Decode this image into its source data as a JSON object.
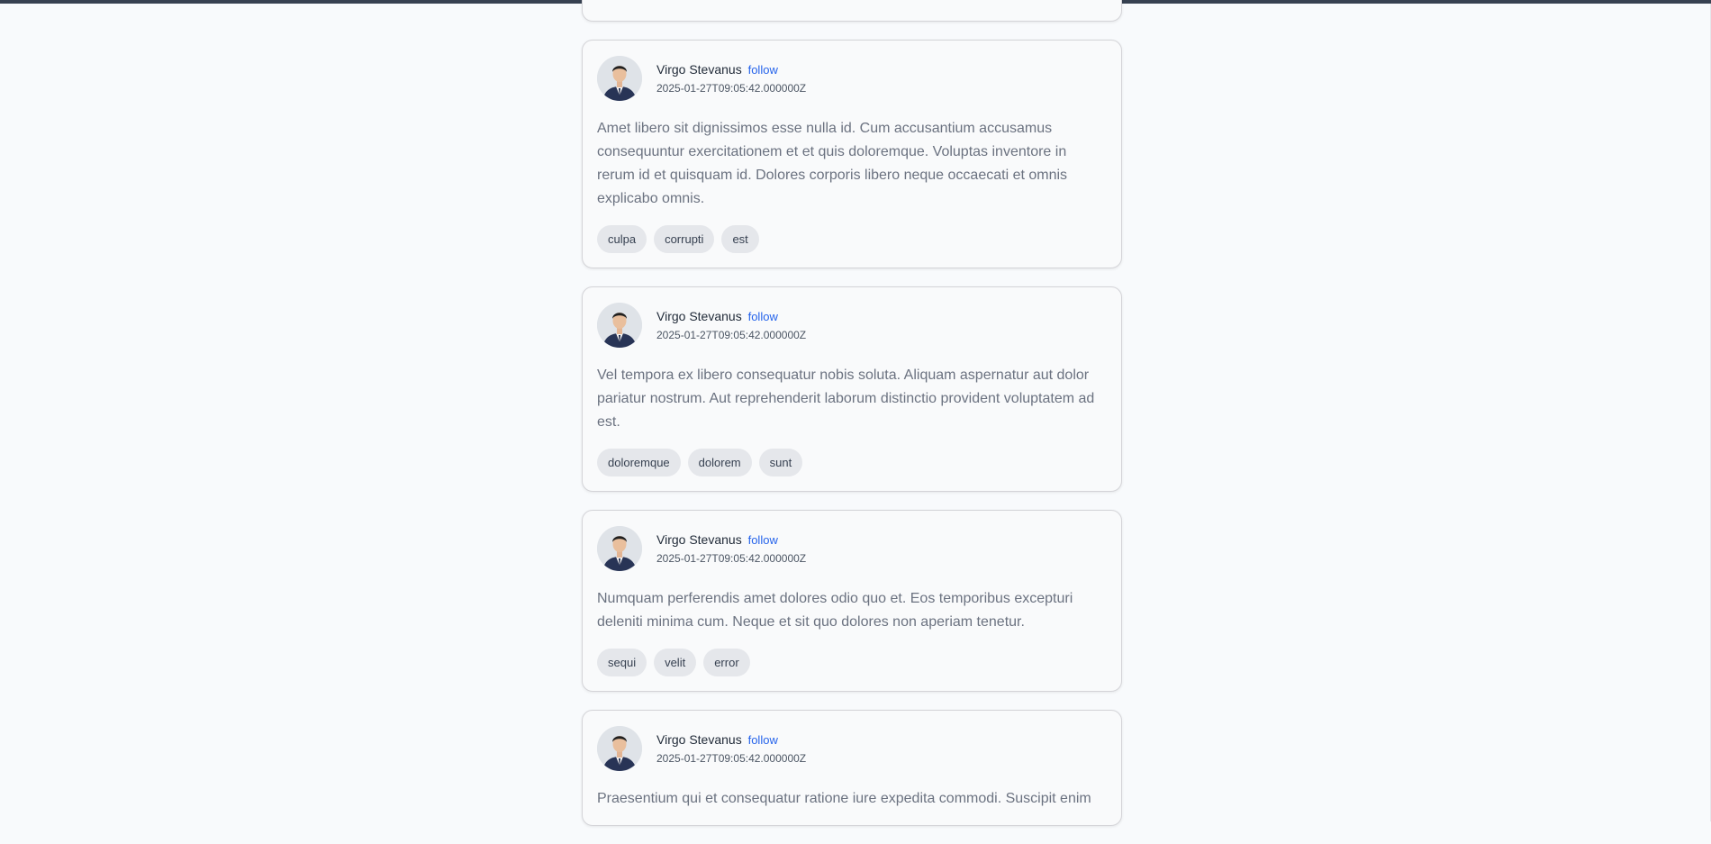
{
  "posts": [
    {
      "author": "Virgo Stevanus",
      "follow_label": "follow",
      "timestamp": "2025-01-27T09:05:42.000000Z",
      "body": "Amet libero sit dignissimos esse nulla id. Cum accusantium accusamus consequuntur exercitationem et et quis doloremque. Voluptas inventore in rerum id et quisquam id. Dolores corporis libero neque occaecati et omnis explicabo omnis.",
      "tags": [
        "culpa",
        "corrupti",
        "est"
      ]
    },
    {
      "author": "Virgo Stevanus",
      "follow_label": "follow",
      "timestamp": "2025-01-27T09:05:42.000000Z",
      "body": "Vel tempora ex libero consequatur nobis soluta. Aliquam aspernatur aut dolor pariatur nostrum. Aut reprehenderit laborum distinctio provident voluptatem ad est.",
      "tags": [
        "doloremque",
        "dolorem",
        "sunt"
      ]
    },
    {
      "author": "Virgo Stevanus",
      "follow_label": "follow",
      "timestamp": "2025-01-27T09:05:42.000000Z",
      "body": "Numquam perferendis amet dolores odio quo et. Eos temporibus excepturi deleniti minima cum. Neque et sit quo dolores non aperiam tenetur.",
      "tags": [
        "sequi",
        "velit",
        "error"
      ]
    },
    {
      "author": "Virgo Stevanus",
      "follow_label": "follow",
      "timestamp": "2025-01-27T09:05:42.000000Z",
      "body": "Praesentium qui et consequatur ratione iure expedita commodi. Suscipit enim",
      "tags": []
    }
  ]
}
